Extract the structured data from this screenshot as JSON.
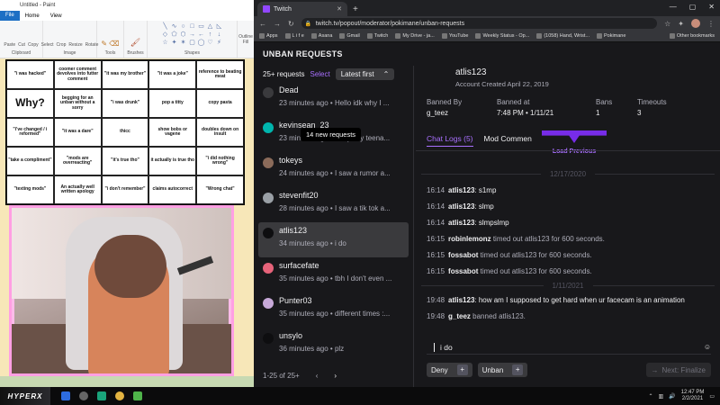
{
  "paint": {
    "title": "Untitled - Paint",
    "tabs": [
      "File",
      "Home",
      "View"
    ],
    "ribbon_groups": [
      "Clipboard",
      "Image",
      "Tools",
      "Brushes",
      "Shapes"
    ],
    "ribbon_items": [
      "Paste",
      "Cut",
      "Copy",
      "Select",
      "Crop",
      "Resize",
      "Rotate",
      "Outline",
      "Fill"
    ],
    "bingo": [
      "\"i was hacked\"",
      "coomer comment devolves into futter comment",
      "\"it was my brother\"",
      "\"it was a joke\"",
      "reference to beating meat",
      "Why?",
      "begging for an unban without a sorry",
      "\"i was drunk\"",
      "pop a titty",
      "copy pasta",
      "\"i've changed / i reformed\"",
      "\"it was a dare\"",
      "thicc",
      "show bobs or vagene",
      "doubles down on insult",
      "\"take a compliment\"",
      "\"mods are overreacting\"",
      "\"it's true tho\"",
      "it actually is true tho",
      "\"i did nothing wrong\"",
      "\"texting mods\"",
      "An actually well written apology",
      "\"i don't remember\"",
      "claims autocorrect",
      "\"Wrong chat\""
    ]
  },
  "browser": {
    "tab_title": "Twitch",
    "url": "twitch.tv/popout/moderator/pokimane/unban-requests",
    "bookmarks": [
      "Apps",
      "L i f e",
      "Asana",
      "Gmail",
      "Twitch",
      "My Drive - ja...",
      "YouTube",
      "Weekly Status - Op...",
      "(1058) Hand, Wrist...",
      "Pokimane",
      "Other bookmarks"
    ]
  },
  "twitch": {
    "header": "UNBAN REQUESTS",
    "count": "25+ requests",
    "select_label": "Select",
    "sort_label": "Latest first",
    "tooltip": "14 new requests",
    "requests": [
      {
        "name": "Dead",
        "time": "23 minutes ago",
        "preview": "Hello idk why I ...",
        "color": "#3a3a3d"
      },
      {
        "name": "kevinsean_23",
        "time": "23 minutes ago",
        "preview": "sorry, my teena...",
        "color": "#00b5ad"
      },
      {
        "name": "tokeys",
        "time": "24 minutes ago",
        "preview": "I saw a rumor a...",
        "color": "#8b6b5a"
      },
      {
        "name": "stevenfit20",
        "time": "28 minutes ago",
        "preview": "I saw a tik tok a...",
        "color": "#9aa0a6"
      },
      {
        "name": "atlis123",
        "time": "34 minutes ago",
        "preview": "i do",
        "color": "#0e0e10"
      },
      {
        "name": "surfacefate",
        "time": "35 minutes ago",
        "preview": "tbh I don't even ...",
        "color": "#e6637a"
      },
      {
        "name": "Punter03",
        "time": "35 minutes ago",
        "preview": "different times :...",
        "color": "#c7a9d8"
      },
      {
        "name": "unsylo",
        "time": "36 minutes ago",
        "preview": "plz",
        "color": "#0e0e10"
      }
    ],
    "pager": "1-25 of 25+",
    "detail": {
      "username": "atlis123",
      "created": "Account Created April 22, 2019",
      "stats": [
        {
          "label": "Banned By",
          "value": "g_teez"
        },
        {
          "label": "Banned at",
          "value": "7:48 PM • 1/11/21"
        },
        {
          "label": "Bans",
          "value": "1"
        },
        {
          "label": "Timeouts",
          "value": "3"
        }
      ],
      "tab_chat": "Chat Logs (5)",
      "tab_mod": "Mod Commen",
      "load_previous": "Load Previous",
      "date1": "12/17/2020",
      "date2": "1/11/2021",
      "messages": [
        {
          "ts": "16:14",
          "who": "atlis123",
          "text": ": s1mp",
          "system": false
        },
        {
          "ts": "16:14",
          "who": "atlis123",
          "text": ": slmp",
          "system": false
        },
        {
          "ts": "16:14",
          "who": "atlis123",
          "text": ": slmpslmp",
          "system": false
        },
        {
          "ts": "16:15",
          "who": "robinlemonz",
          "text": " timed out atlis123 for 600 seconds.",
          "system": true
        },
        {
          "ts": "16:15",
          "who": "fossabot",
          "text": " timed out atlis123 for 600 seconds.",
          "system": true
        },
        {
          "ts": "16:15",
          "who": "fossabot",
          "text": " timed out atlis123 for 600 seconds.",
          "system": true
        },
        {
          "ts": "19:48",
          "who": "atlis123",
          "text": ": how am I supposed to get hard when ur facecam is an animation",
          "system": false
        },
        {
          "ts": "19:48",
          "who": "g_teez",
          "text": " banned atlis123.",
          "system": true
        }
      ],
      "reply": "i do",
      "deny_label": "Deny",
      "unban_label": "Unban",
      "finalize_label": "Next: Finalize"
    }
  },
  "taskbar": {
    "brand": "HYPERX",
    "time": "12:47 PM",
    "date": "2/2/2021"
  }
}
